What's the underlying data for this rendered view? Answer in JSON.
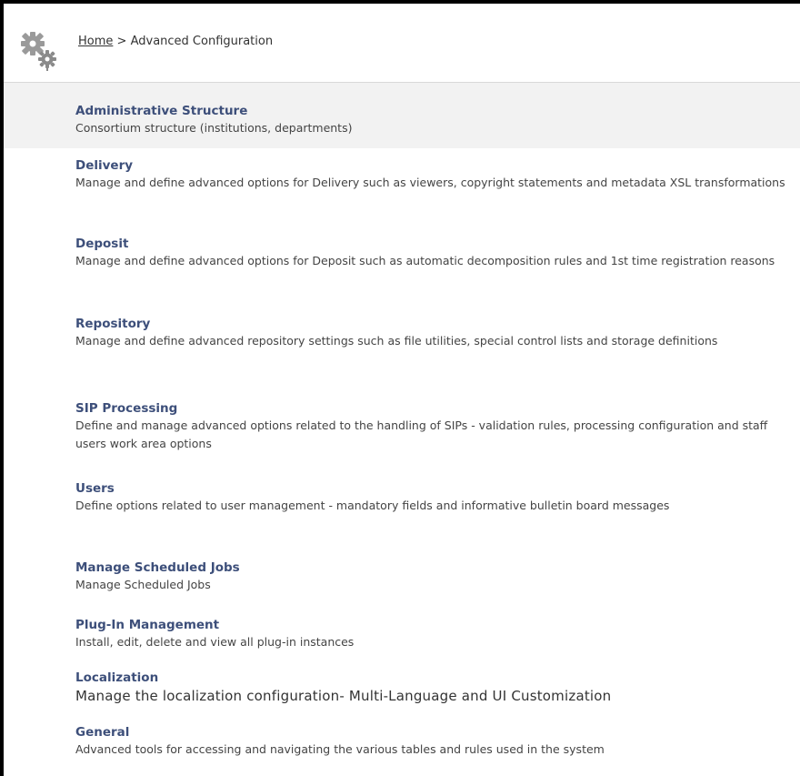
{
  "breadcrumb": {
    "home": "Home",
    "separator": ">",
    "current": "Advanced Configuration"
  },
  "icons": {
    "header_icon": "gears-icon"
  },
  "colors": {
    "link": "#3d4f7a",
    "band": "#f2f2f2"
  },
  "items": [
    {
      "title": "Administrative Structure",
      "description": "Consortium structure (institutions, departments)"
    },
    {
      "title": "Delivery",
      "description": "Manage and define advanced options for Delivery such as viewers, copyright statements and metadata XSL transformations"
    },
    {
      "title": "Deposit",
      "description": "Manage and define advanced options for Deposit such as automatic decomposition rules and 1st time registration reasons"
    },
    {
      "title": "Repository",
      "description": "Manage and define advanced repository settings such as file utilities, special control lists and storage definitions"
    },
    {
      "title": "SIP Processing",
      "description": "Define and manage advanced options related to the handling of SIPs - validation rules, processing configuration and staff users work area options"
    },
    {
      "title": "Users",
      "description": "Define options related to user management - mandatory fields and informative bulletin board messages"
    },
    {
      "title": "Manage Scheduled Jobs",
      "description": "Manage Scheduled Jobs"
    },
    {
      "title": "Plug-In Management",
      "description": "Install, edit, delete and view all plug-in instances"
    },
    {
      "title": "Localization",
      "description": "Manage the localization configuration- Multi-Language and UI Customization"
    },
    {
      "title": "General",
      "description": "Advanced tools for accessing and navigating the various tables and rules used in the system"
    }
  ]
}
